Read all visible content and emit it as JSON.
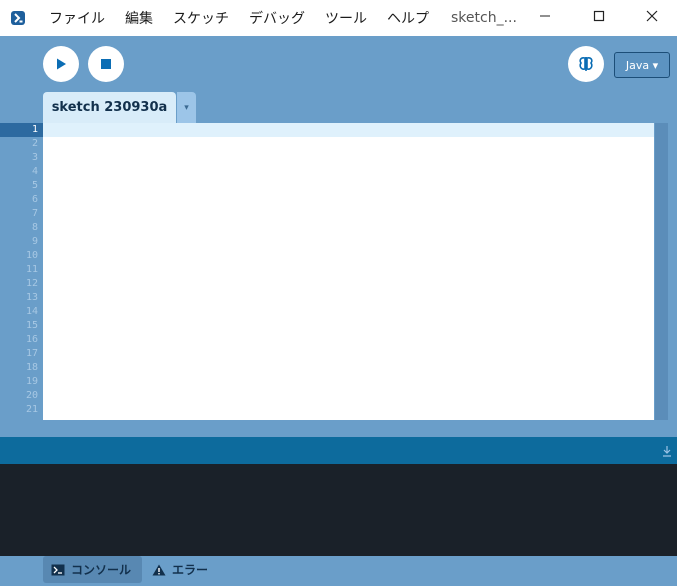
{
  "menu": {
    "file": "ファイル",
    "edit": "編集",
    "sketch": "スケッチ",
    "debug": "デバッグ",
    "tools": "ツール",
    "help": "ヘルプ"
  },
  "window": {
    "title": "sketch_..."
  },
  "toolbar": {
    "mode_label": "Java ▾"
  },
  "tabs": {
    "sketch_name": "sketch 230930a",
    "menu_arrow": "▾"
  },
  "editor": {
    "line_numbers": [
      "1",
      "2",
      "3",
      "4",
      "5",
      "6",
      "7",
      "8",
      "9",
      "10",
      "11",
      "12",
      "13",
      "14",
      "15",
      "16",
      "17",
      "18",
      "19",
      "20",
      "21"
    ],
    "current_line": 1
  },
  "bottom_tabs": {
    "console_label": "コンソール",
    "errors_label": "エラー"
  },
  "icons": {
    "app": "processing-logo-icon",
    "run": "play-icon",
    "stop": "stop-icon",
    "debug": "butterfly-icon",
    "console": "terminal-icon",
    "errors": "warning-icon",
    "clear": "arrow-down-icon"
  },
  "colors": {
    "background": "#6a9ec9",
    "console_header": "#0d6b9d",
    "console_bg": "#1a2129",
    "accent": "#0b6db4"
  }
}
